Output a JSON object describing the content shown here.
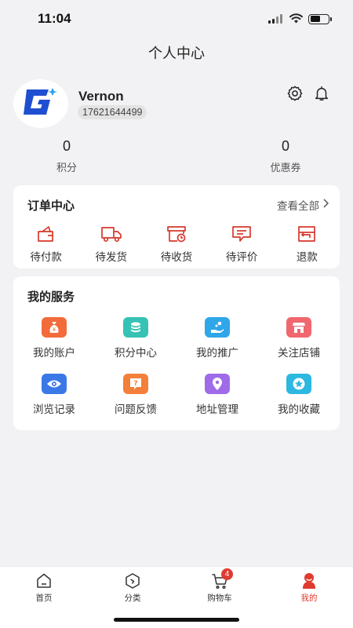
{
  "status_bar": {
    "time": "11:04"
  },
  "header": {
    "title": "个人中心"
  },
  "profile": {
    "username": "Vernon",
    "phone": "17621644499",
    "avatar_icon": "g-logo-icon"
  },
  "stats": [
    {
      "value": "0",
      "label": "积分"
    },
    {
      "value": "0",
      "label": "优惠券"
    }
  ],
  "orders": {
    "title": "订单中心",
    "view_all": "查看全部",
    "items": [
      {
        "label": "待付款",
        "icon": "wallet-icon"
      },
      {
        "label": "待发货",
        "icon": "truck-icon"
      },
      {
        "label": "待收货",
        "icon": "box-clock-icon"
      },
      {
        "label": "待评价",
        "icon": "comment-icon"
      },
      {
        "label": "退款",
        "icon": "refund-icon"
      }
    ]
  },
  "services": {
    "title": "我的服务",
    "items": [
      {
        "label": "我的账户",
        "icon": "money-bag-icon",
        "color": "#f36b3b"
      },
      {
        "label": "积分中心",
        "icon": "coins-icon",
        "color": "#36c2b4"
      },
      {
        "label": "我的推广",
        "icon": "hand-share-icon",
        "color": "#2fa6e8"
      },
      {
        "label": "关注店铺",
        "icon": "store-icon",
        "color": "#f0676f"
      },
      {
        "label": "浏览记录",
        "icon": "eye-icon",
        "color": "#3b78e7"
      },
      {
        "label": "问题反馈",
        "icon": "question-icon",
        "color": "#f47f3a"
      },
      {
        "label": "地址管理",
        "icon": "location-icon",
        "color": "#a06be8"
      },
      {
        "label": "我的收藏",
        "icon": "star-icon",
        "color": "#2cb8e0"
      }
    ]
  },
  "tab_bar": {
    "tabs": [
      {
        "label": "首页",
        "icon": "home-icon"
      },
      {
        "label": "分类",
        "icon": "category-icon"
      },
      {
        "label": "购物车",
        "icon": "cart-icon",
        "badge": "4"
      },
      {
        "label": "我的",
        "icon": "profile-icon",
        "active": true
      }
    ]
  },
  "colors": {
    "accent": "#e03a2f",
    "brand_blue": "#1f4fd1"
  }
}
